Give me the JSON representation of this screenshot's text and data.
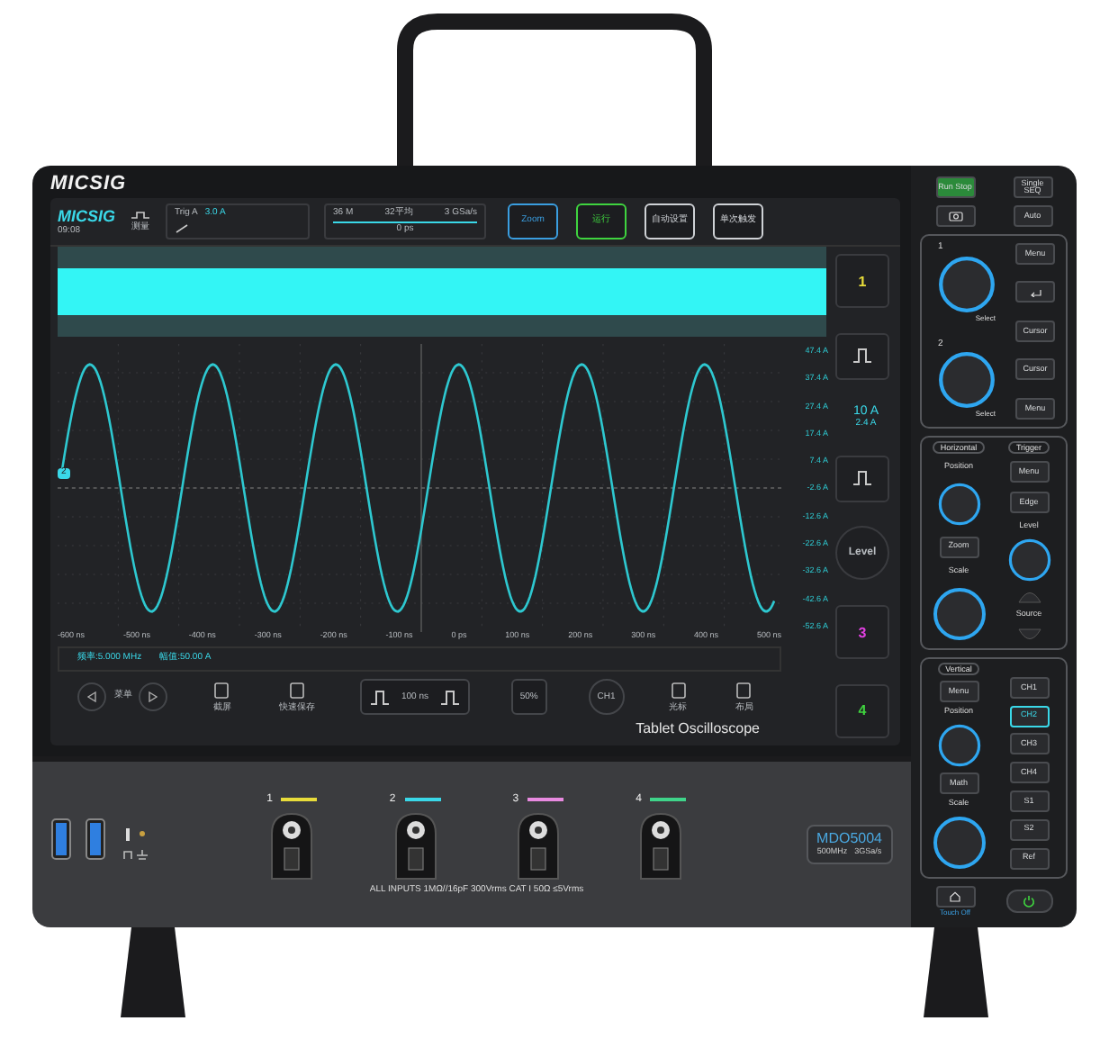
{
  "bezel": {
    "brand": "MICSIG",
    "product_line": "Tablet Oscilloscope"
  },
  "screen": {
    "logo": "MICSIG",
    "time": "09:08",
    "measure": {
      "label": "测量"
    },
    "trigger": {
      "source": "Trig A",
      "level": "3.0 A"
    },
    "timebase": {
      "memory": "36 M",
      "mode": "32平均",
      "rate": "3 GSa/s",
      "offset": "0 ps"
    },
    "top_buttons": [
      {
        "label": "Zoom",
        "color": "#3a9ee0"
      },
      {
        "label": "运行",
        "color": "#3fd43f"
      },
      {
        "label": "自动设置",
        "color": "#cfd2d6"
      },
      {
        "label": "单次触发",
        "color": "#cfd2d6"
      }
    ],
    "y_labels": [
      "47.4 A",
      "37.4 A",
      "27.4 A",
      "17.4 A",
      "7.4 A",
      "-2.6 A",
      "-12.6 A",
      "-22.6 A",
      "-32.6 A",
      "-42.6 A",
      "-52.6 A"
    ],
    "x_labels": [
      "-600 ns",
      "-500 ns",
      "-400 ns",
      "-300 ns",
      "-200 ns",
      "-100 ns",
      "0 ps",
      "100 ns",
      "200 ns",
      "300 ns",
      "400 ns",
      "500 ns"
    ],
    "channel_marker": "2",
    "measurements": [
      "频率:5.000 MHz",
      "幅值:50.00 A"
    ],
    "side_buttons": [
      {
        "kind": "channel",
        "label": "1",
        "color": "#e8dc3a"
      },
      {
        "kind": "edge"
      },
      {
        "kind": "info",
        "lines": [
          "10 A",
          "2.4 A"
        ]
      },
      {
        "kind": "edge"
      },
      {
        "kind": "level",
        "label": "Level"
      },
      {
        "kind": "channel",
        "label": "3",
        "color": "#e040e0"
      },
      {
        "kind": "channel",
        "label": "4",
        "color": "#3fd43f"
      }
    ],
    "toolbar": [
      {
        "kind": "nav",
        "label": "菜单"
      },
      {
        "kind": "icon",
        "label": "截屏"
      },
      {
        "kind": "icon",
        "label": "快速保存"
      },
      {
        "kind": "timebase",
        "label": "100 ns"
      },
      {
        "kind": "boxed",
        "label": "50%"
      },
      {
        "kind": "round",
        "label": "CH1"
      },
      {
        "kind": "icon",
        "label": "光标"
      },
      {
        "kind": "icon",
        "label": "布局"
      }
    ]
  },
  "control_panel": {
    "top_buttons": [
      {
        "kind": "run",
        "label": "Run Stop"
      },
      {
        "kind": "text",
        "label": "Single SEQ"
      },
      {
        "kind": "camera"
      },
      {
        "kind": "text",
        "label": "Auto"
      }
    ],
    "knobs": [
      {
        "label": "1",
        "caption": "Select"
      },
      {
        "label": "2",
        "caption": "Select"
      }
    ],
    "multi_buttons": [
      {
        "kind": "text",
        "label": "Menu"
      },
      {
        "kind": "back"
      },
      {
        "kind": "text",
        "label": "Cursor"
      },
      {
        "kind": "text",
        "label": "Cursor"
      },
      {
        "kind": "text",
        "label": "Menu"
      }
    ],
    "horizontal": {
      "title": "Horizontal",
      "position": "Position",
      "zoom": "Zoom",
      "scale": "Scale"
    },
    "trigger": {
      "title": "Trigger",
      "buttons": [
        "Menu",
        "Edge"
      ],
      "level": "Level",
      "source": "Source"
    },
    "vertical": {
      "title": "Vertical",
      "menu": "Menu",
      "position": "Position",
      "math": "Math",
      "scale": "Scale",
      "channels": [
        {
          "label": "CH1",
          "selected": false
        },
        {
          "label": "CH2",
          "selected": true
        },
        {
          "label": "CH3",
          "selected": false
        },
        {
          "label": "CH4",
          "selected": false
        }
      ],
      "extra_buttons": [
        "S1",
        "S2",
        "Ref"
      ]
    },
    "touch_label": "Touch Off"
  },
  "front": {
    "inputs": [
      {
        "label": "1",
        "color": "#e8dc3a"
      },
      {
        "label": "2",
        "color": "#3ad8e8"
      },
      {
        "label": "3",
        "color": "#e88ae0"
      },
      {
        "label": "4",
        "color": "#3fd48a"
      }
    ],
    "rating": "ALL INPUTS 1MΩ//16pF 300Vrms CAT I 50Ω ≤5Vrms",
    "model": {
      "name": "MDO5004",
      "bandwidth": "500MHz",
      "sample_rate": "3GSa/s"
    }
  }
}
